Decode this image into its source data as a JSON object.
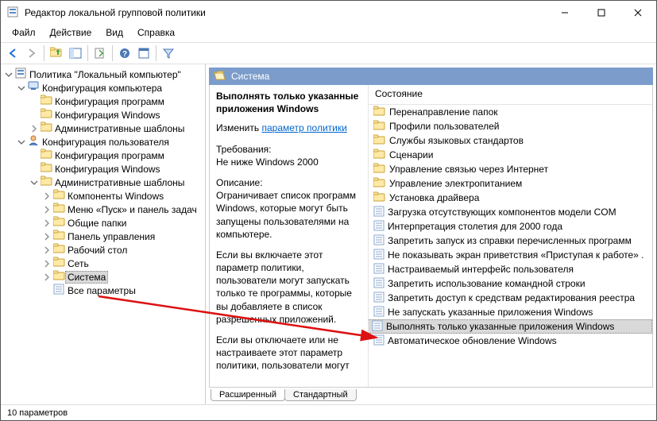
{
  "window": {
    "title": "Редактор локальной групповой политики"
  },
  "menu": {
    "file": "Файл",
    "action": "Действие",
    "view": "Вид",
    "help": "Справка"
  },
  "tree": {
    "root": "Политика \"Локальный компьютер\"",
    "comp": "Конфигурация компьютера",
    "comp_children": [
      "Конфигурация программ",
      "Конфигурация Windows",
      "Административные шаблоны"
    ],
    "user": "Конфигурация пользователя",
    "user_children": [
      "Конфигурация программ",
      "Конфигурация Windows"
    ],
    "admin_tpl": "Административные шаблоны",
    "admin_children": [
      "Компоненты Windows",
      "Меню «Пуск» и панель задач",
      "Общие папки",
      "Панель управления",
      "Рабочий стол",
      "Сеть"
    ],
    "system": "Система",
    "all_params": "Все параметры"
  },
  "header": {
    "title": "Система"
  },
  "detail": {
    "title": "Выполнять только указанные приложения Windows",
    "edit_label": "Изменить",
    "edit_link": "параметр политики",
    "req_label": "Требования:",
    "req_val": "Не ниже Windows 2000",
    "desc_label": "Описание:",
    "desc1": "Ограничивает список программ Windows, которые могут быть запущены пользователями на компьютере.",
    "desc2": "Если вы включаете этот параметр политики, пользователи могут запускать только те программы, которые вы добавляете в список разрешенных приложений.",
    "desc3": "Если вы отключаете или не настраиваете этот параметр политики, пользователи могут"
  },
  "list": {
    "header": "Состояние",
    "folders": [
      "Перенаправление папок",
      "Профили пользователей",
      "Службы языковых стандартов",
      "Сценарии",
      "Управление связью через Интернет",
      "Управление электропитанием",
      "Установка драйвера"
    ],
    "settings": [
      "Загрузка отсутствующих компонентов модели COM",
      "Интерпретация столетия для 2000 года",
      "Запретить запуск из справки перечисленных программ",
      "Не показывать экран приветствия «Приступая к работе» .",
      "Настраиваемый интерфейс пользователя",
      "Запретить использование командной строки",
      "Запретить доступ к средствам редактирования реестра",
      "Не запускать указанные приложения Windows",
      "Выполнять только указанные приложения Windows",
      "Автоматическое обновление Windows"
    ],
    "selected_index": 8
  },
  "tabs": {
    "extended": "Расширенный",
    "standard": "Стандартный"
  },
  "status": {
    "text": "10 параметров"
  }
}
